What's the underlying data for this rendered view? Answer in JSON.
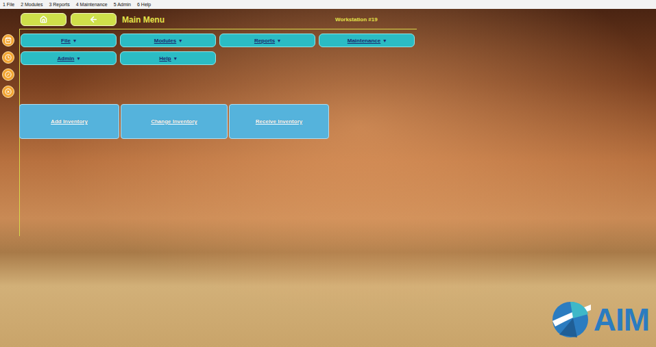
{
  "menubar": [
    {
      "label": "1 File"
    },
    {
      "label": "2 Modules"
    },
    {
      "label": "3 Reports"
    },
    {
      "label": "4 Maintenance"
    },
    {
      "label": "5 Admin"
    },
    {
      "label": "6 Help"
    }
  ],
  "header": {
    "title": "Main Menu",
    "workstation": "Workstation #19"
  },
  "menus": [
    {
      "label": "File",
      "arrow": "▾"
    },
    {
      "label": "Modules",
      "arrow": "▾"
    },
    {
      "label": "Reports",
      "arrow": "▾"
    },
    {
      "label": "Maintenance",
      "arrow": "▾"
    },
    {
      "label": "Admin",
      "arrow": "▾"
    },
    {
      "label": "Help",
      "arrow": "▾"
    }
  ],
  "tiles": [
    {
      "label": "Add Inventory"
    },
    {
      "label": "Change Inventory"
    },
    {
      "label": "Receive Inventory"
    }
  ],
  "logo": {
    "text": "AIM"
  }
}
